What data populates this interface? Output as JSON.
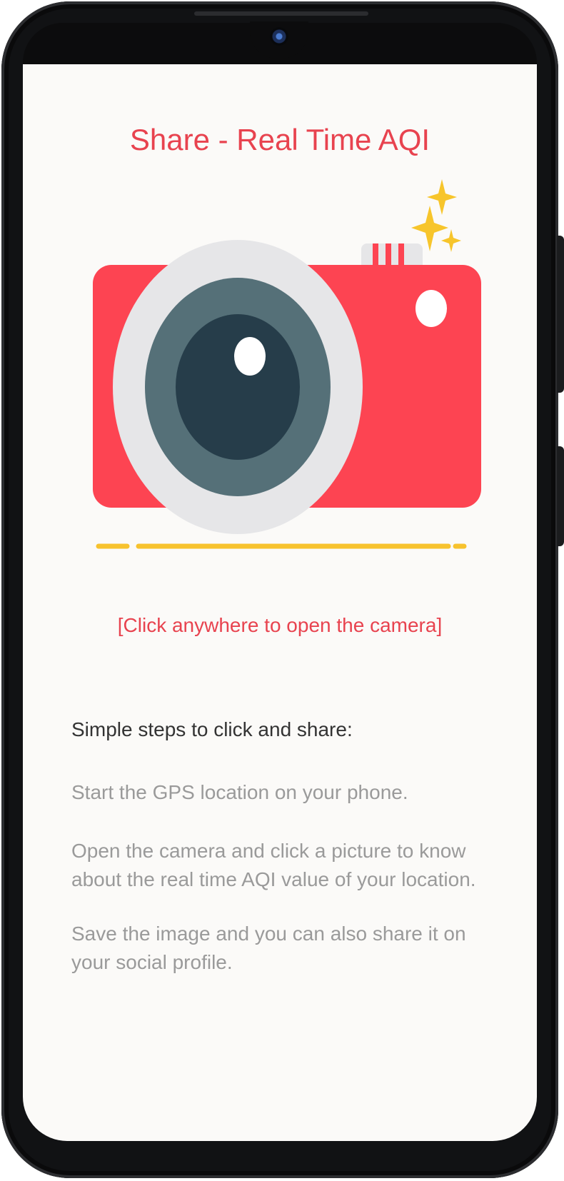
{
  "header": {
    "title": "Share - Real Time AQI"
  },
  "camera_illustration": {
    "icon": "camera-icon",
    "accent": "#fd4452",
    "lens_ring": "#e6e6e8",
    "lens_outer": "#557078",
    "lens_inner": "#263d4a",
    "sparkle": "#f7c52b"
  },
  "hint_text": "[Click anywhere to open the camera]",
  "steps": {
    "heading": "Simple steps to click and share:",
    "items": [
      "Start the GPS location on your phone.",
      "Open the camera and click a picture to know about the real time AQI value of your location.",
      "Save the image and you can also share it on your social profile."
    ]
  }
}
